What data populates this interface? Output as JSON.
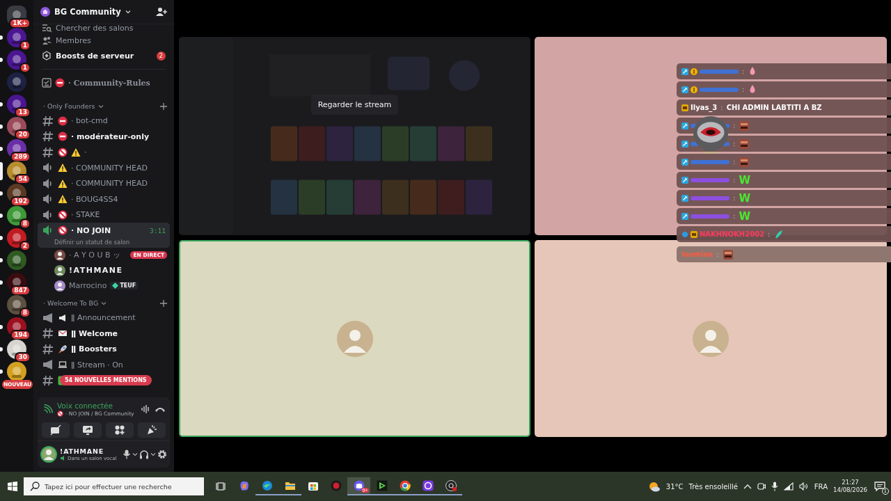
{
  "servers": [
    {
      "badge": "1K+",
      "unread": false,
      "selected": false,
      "color": "#3a3b42"
    },
    {
      "badge": "1",
      "unread": true,
      "selected": false,
      "color": "#4b1691"
    },
    {
      "badge": "1",
      "unread": true,
      "selected": false,
      "color": "#4b1691"
    },
    {
      "unread": false,
      "selected": false,
      "color": "#1d2142"
    },
    {
      "badge": "13",
      "unread": true,
      "selected": false,
      "color": "#4b1691"
    },
    {
      "badge": "20",
      "unread": true,
      "selected": false,
      "color": "#9c4b5a"
    },
    {
      "badge": "289",
      "unread": true,
      "selected": false,
      "color": "#6a2fa8"
    },
    {
      "badge": "54",
      "unread": false,
      "selected": true,
      "color": "#b88d2e"
    },
    {
      "badge": "192",
      "unread": true,
      "selected": false,
      "color": "#5a3a24"
    },
    {
      "badge": "8",
      "unread": true,
      "selected": false,
      "color": "#3f9a3a"
    },
    {
      "badge": "2",
      "unread": true,
      "selected": false,
      "color": "#c01c22"
    },
    {
      "unread": true,
      "selected": false,
      "color": "#2f5a22"
    },
    {
      "badge": "847",
      "unread": true,
      "selected": false,
      "color": "#3a0c10"
    },
    {
      "badge": "8",
      "unread": false,
      "selected": false,
      "color": "#5c5040"
    },
    {
      "badge": "194",
      "unread": true,
      "selected": false,
      "color": "#9c1020"
    },
    {
      "badge": "30",
      "unread": true,
      "selected": false,
      "color": "#d6d4cf"
    },
    {
      "unread": true,
      "selected": false,
      "color": "#d4a020"
    }
  ],
  "new_badge": "NOUVEAU",
  "server_header": {
    "name": "BG Community"
  },
  "nav_items": [
    {
      "kind": "search",
      "label": "Chercher des salons",
      "unread": false
    },
    {
      "kind": "members",
      "label": "Membres",
      "unread": false
    },
    {
      "kind": "boosts",
      "label": "Boosts de serveur",
      "unread": true,
      "badge": "2"
    }
  ],
  "pinned_channel": {
    "emojis": [
      {
        "kind": "no-entry"
      }
    ],
    "name": "· Community-Rules"
  },
  "categories": [
    {
      "name": "· Only Founders",
      "channels": [
        {
          "kind": "text",
          "emojis": [
            {
              "kind": "no-entry"
            }
          ],
          "name": "· bot-cmd",
          "unread": false
        },
        {
          "kind": "text",
          "emojis": [
            {
              "kind": "no-entry"
            }
          ],
          "name": "· modérateur-only",
          "unread": true
        },
        {
          "kind": "text",
          "emojis": [
            {
              "kind": "prohibited"
            },
            {
              "kind": "warning"
            }
          ],
          "name": "·",
          "unread": false
        },
        {
          "kind": "voice",
          "emojis": [
            {
              "kind": "warning"
            }
          ],
          "name": "· COMMUNITY HEAD",
          "unread": false
        },
        {
          "kind": "voice",
          "emojis": [
            {
              "kind": "warning"
            }
          ],
          "name": "· COMMUNITY HEAD",
          "unread": false
        },
        {
          "kind": "voice",
          "emojis": [
            {
              "kind": "warning"
            }
          ],
          "name": "· BOUG4SS4",
          "unread": false
        },
        {
          "kind": "voice",
          "emojis": [
            {
              "kind": "prohibited"
            }
          ],
          "name": "· STAKE",
          "unread": false
        },
        {
          "kind": "voice",
          "emojis": [
            {
              "kind": "prohibited"
            }
          ],
          "name": "· NO JOIN",
          "unread": true,
          "connected": true,
          "time": "3:11",
          "status": "Définir un statut de salon",
          "members": [
            {
              "name": "· A Y O U B ッ",
              "self": false,
              "badge": "EN DIRECT"
            },
            {
              "name": "!ATHMANE",
              "self": true
            },
            {
              "name": "Marrocino",
              "self": false,
              "tag": "TEUF"
            }
          ]
        }
      ]
    },
    {
      "name": "· Welcome To BG",
      "channels": [
        {
          "kind": "announce",
          "emojis": [
            {
              "kind": "megaphone"
            }
          ],
          "name": "ǁ Announcement",
          "unread": false
        },
        {
          "kind": "text",
          "emojis": [
            {
              "kind": "envelope"
            }
          ],
          "name": "ǁ Welcome",
          "unread": true
        },
        {
          "kind": "text",
          "emojis": [
            {
              "kind": "rocket"
            }
          ],
          "name": "ǁ Boosters",
          "unread": true
        },
        {
          "kind": "announce",
          "emojis": [
            {
              "kind": "laptop"
            }
          ],
          "name": "ǁ Stream · On",
          "unread": false
        },
        {
          "kind": "text",
          "emojis": [
            {
              "kind": "check"
            }
          ],
          "mentions": "54 NOUVELLES MENTIONS"
        }
      ]
    }
  ],
  "voice_panel": {
    "title": "Voix connectée",
    "channel": "· NO JOIN / BG Community"
  },
  "user_panel": {
    "name": "!ATHMANE",
    "status": "Dans un salon vocal"
  },
  "tiles": [
    {
      "kind": "stream",
      "overlay": "Regarder le stream",
      "color": "#1b1b1d",
      "speaking": false
    },
    {
      "kind": "camera-off",
      "color": "#d3a4a4",
      "speaking": false
    },
    {
      "kind": "camera-off",
      "color": "#dbd9bf",
      "speaking": true
    },
    {
      "kind": "camera-off",
      "color": "#e6c6b8",
      "speaking": false
    }
  ],
  "chat": [
    {
      "badges": [
        {
          "kind": "mod"
        },
        {
          "kind": "coin"
        }
      ],
      "color": "#3f72d4",
      "separator": ":",
      "emotes": [
        {
          "kind": "drop"
        }
      ]
    },
    {
      "badges": [
        {
          "kind": "mod"
        },
        {
          "kind": "coin"
        }
      ],
      "color": "#3f72d4",
      "separator": ":",
      "emotes": [
        {
          "kind": "drop"
        }
      ]
    },
    {
      "badges": [
        {
          "kind": "sub"
        }
      ],
      "user": "Ilyas_3",
      "color": "#ffffff",
      "separator": ":",
      "message": "CHI ADMIN LABTITI A BZ",
      "big": false
    },
    {
      "badges": [
        {
          "kind": "mod"
        }
      ],
      "color": "#3f72d4",
      "separator": ":",
      "emotes": [
        {
          "kind": "face"
        }
      ]
    },
    {
      "badges": [
        {
          "kind": "mod"
        }
      ],
      "color": "#3f72d4",
      "separator": ":",
      "emotes": [
        {
          "kind": "face"
        }
      ]
    },
    {
      "badges": [
        {
          "kind": "mod"
        }
      ],
      "color": "#3f72d4",
      "separator": ":",
      "emotes": [
        {
          "kind": "face"
        }
      ]
    },
    {
      "badges": [
        {
          "kind": "mod"
        }
      ],
      "color": "#8c4fe0",
      "separator": ":",
      "message": "W",
      "big": true
    },
    {
      "badges": [
        {
          "kind": "mod"
        }
      ],
      "color": "#8c4fe0",
      "separator": ":",
      "message": "W",
      "big": true
    },
    {
      "badges": [
        {
          "kind": "mod"
        }
      ],
      "color": "#8c4fe0",
      "separator": ":",
      "message": "W",
      "big": true
    },
    {
      "badges": [
        {
          "kind": "gem"
        },
        {
          "kind": "sub"
        }
      ],
      "user": "NAKHNOKH2002",
      "color": "#ff3a5c",
      "separator": ":",
      "emotes": [
        {
          "kind": "feather"
        }
      ]
    },
    {
      "user": "loumina",
      "color": "#ff5a40",
      "separator": ":",
      "emotes": [
        {
          "kind": "face"
        }
      ]
    }
  ],
  "taskbar": {
    "search_placeholder": "Tapez ici pour effectuer une recherche",
    "apps": [
      {
        "kind": "task-view",
        "active": false,
        "selected": false
      },
      {
        "kind": "copilot",
        "active": false,
        "selected": false
      },
      {
        "kind": "edge",
        "active": true,
        "selected": false
      },
      {
        "kind": "folder",
        "active": true,
        "selected": false
      },
      {
        "kind": "store",
        "active": false,
        "selected": false
      },
      {
        "kind": "red-app",
        "active": false,
        "selected": false
      },
      {
        "kind": "discord",
        "active": true,
        "selected": true,
        "badge": "9+"
      },
      {
        "kind": "green-app",
        "active": true,
        "selected": false
      },
      {
        "kind": "chrome",
        "active": true,
        "selected": false
      },
      {
        "kind": "ring",
        "active": true,
        "selected": false
      },
      {
        "kind": "obs",
        "active": true,
        "selected": false
      }
    ],
    "temperature": "31°C",
    "weather": "Très ensoleillé",
    "language": "FRA",
    "time": "21:27",
    "date": "14/08/2026",
    "notifications": "1"
  }
}
